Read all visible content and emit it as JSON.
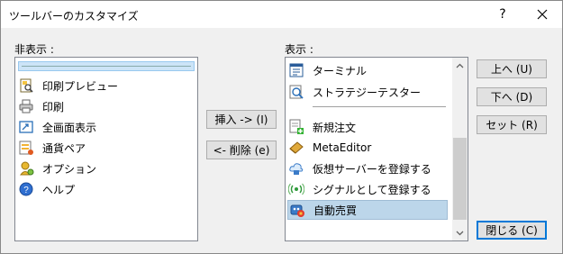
{
  "window": {
    "title": "ツールバーのカスタマイズ",
    "help_label": "?",
    "close_icon": "close-icon"
  },
  "hidden_list": {
    "label": "非表示 :",
    "items": [
      {
        "label": "",
        "icon": "separator",
        "selected": true
      },
      {
        "label": "印刷プレビュー",
        "icon": "print-preview-icon"
      },
      {
        "label": "印刷",
        "icon": "print-icon"
      },
      {
        "label": "全画面表示",
        "icon": "fullscreen-icon"
      },
      {
        "label": "通貨ペア",
        "icon": "currency-pairs-icon"
      },
      {
        "label": "オプション",
        "icon": "options-icon"
      },
      {
        "label": "ヘルプ",
        "icon": "help-icon"
      }
    ]
  },
  "shown_list": {
    "label": "表示 :",
    "items": [
      {
        "label": "ターミナル",
        "icon": "terminal-icon"
      },
      {
        "label": "ストラテジーテスター",
        "icon": "strategy-tester-icon"
      },
      {
        "label": "",
        "icon": "separator"
      },
      {
        "label": "新規注文",
        "icon": "new-order-icon"
      },
      {
        "label": "MetaEditor",
        "icon": "metaeditor-icon"
      },
      {
        "label": "仮想サーバーを登録する",
        "icon": "virtual-server-icon"
      },
      {
        "label": "シグナルとして登録する",
        "icon": "signal-icon"
      },
      {
        "label": "自動売買",
        "icon": "auto-trading-icon",
        "selected": true
      }
    ]
  },
  "buttons": {
    "insert": "挿入 -> (I)",
    "remove": "<- 削除 (e)",
    "up": "上へ (U)",
    "down": "下へ (D)",
    "reset": "セット (R)",
    "close": "閉じる (C)"
  },
  "colors": {
    "selection": "#bcd6ea",
    "default_button_border": "#0078d7"
  }
}
